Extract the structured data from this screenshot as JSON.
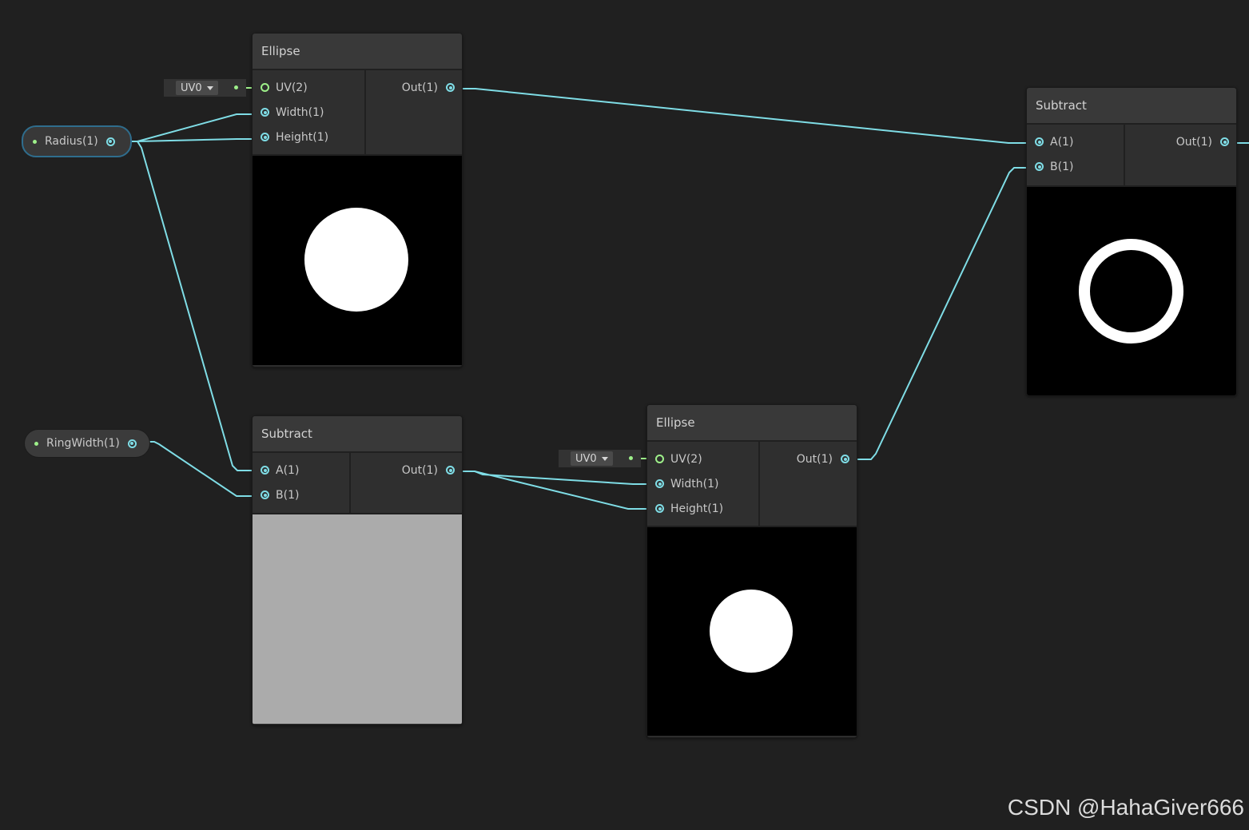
{
  "nodes": {
    "ellipse_top": {
      "title": "Ellipse",
      "inputs": [
        "UV(2)",
        "Width(1)",
        "Height(1)"
      ],
      "output": "Out(1)",
      "uv_dropdown": "UV0"
    },
    "subtract_top": {
      "title": "Subtract",
      "inputs": [
        "A(1)",
        "B(1)"
      ],
      "output": "Out(1)"
    },
    "subtract_mid": {
      "title": "Subtract",
      "inputs": [
        "A(1)",
        "B(1)"
      ],
      "output": "Out(1)"
    },
    "ellipse_bottom": {
      "title": "Ellipse",
      "inputs": [
        "UV(2)",
        "Width(1)",
        "Height(1)"
      ],
      "output": "Out(1)",
      "uv_dropdown": "UV0"
    }
  },
  "properties": {
    "radius": "Radius(1)",
    "ring_width": "RingWidth(1)"
  },
  "watermark": "CSDN @HahaGiver666",
  "colors": {
    "background": "#202020",
    "wire": "#7fdde6",
    "uv_port": "#9ef08a",
    "selection": "#2f6d8d"
  }
}
